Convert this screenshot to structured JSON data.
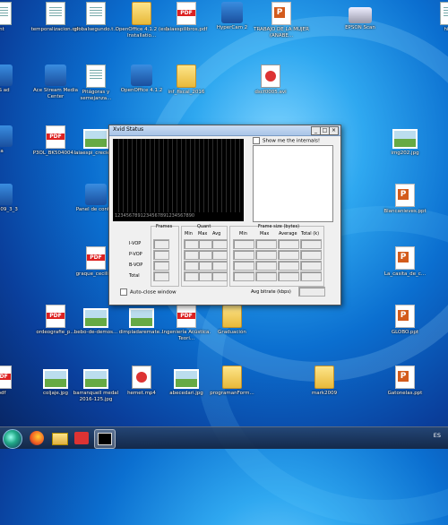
{
  "desktop": {
    "icons": [
      {
        "label": "nt",
        "type": "doc"
      },
      {
        "label": "temporalizacion.odt",
        "type": "doc"
      },
      {
        "label": "globalsegundo.t...",
        "type": "doc"
      },
      {
        "label": "OpenOffice 4.1.2 (es) Installatio...",
        "type": "folder"
      },
      {
        "label": "laiaespilibros.pdf",
        "type": "pdf"
      },
      {
        "label": "HyperCam 2",
        "type": "app"
      },
      {
        "label": "TRABAJO DE LA MUJER (ANABE...",
        "type": "ppt"
      },
      {
        "label": "EPSON Scan",
        "type": "scan"
      },
      {
        "label": "hiwa",
        "type": "doc"
      },
      {
        "label": "ISS ad",
        "type": "app"
      },
      {
        "label": "Ace Stream Media Center",
        "type": "app"
      },
      {
        "label": "Pitágoras y semejanza...",
        "type": "doc"
      },
      {
        "label": "OpenOffice 4.1.2",
        "type": "app"
      },
      {
        "label": "inf_fiscal_2016",
        "type": "folder"
      },
      {
        "label": "dscf0005.avi",
        "type": "vid"
      },
      {
        "label": "a",
        "type": "app"
      },
      {
        "label": "P3OL_BK504004...",
        "type": "pdf"
      },
      {
        "label": "laiaespi_crecien...",
        "type": "img"
      },
      {
        "label": "img202.jpg",
        "type": "img"
      },
      {
        "label": "Blancanieves.ppt",
        "type": "ppt"
      },
      {
        "label": "DJI 2009_3_3",
        "type": "app"
      },
      {
        "label": "Panel de control",
        "type": "app"
      },
      {
        "label": "La_casita_de_c...",
        "type": "ppt"
      },
      {
        "label": "graque_cecilia...",
        "type": "pdf"
      },
      {
        "label": "ordeografie_p...",
        "type": "pdf"
      },
      {
        "label": "bebo-de-demos...",
        "type": "img"
      },
      {
        "label": "dimpladaremate...",
        "type": "img"
      },
      {
        "label": "Ingeniería Acústica. Teori...",
        "type": "pdf"
      },
      {
        "label": "Graduación",
        "type": "folder"
      },
      {
        "label": "GLOBO.ppt",
        "type": "ppt"
      },
      {
        "label": "coljaje.jpg",
        "type": "img"
      },
      {
        "label": "barranquell medal 2016-125.jpg",
        "type": "img"
      },
      {
        "label": "hemet.mp4",
        "type": "vid"
      },
      {
        "label": "abecedari.jpg",
        "type": "img"
      },
      {
        "label": "programanForm...",
        "type": "folder"
      },
      {
        "label": "mark2009",
        "type": "folder"
      },
      {
        "label": "Gatonelas.ppt",
        "type": "ppt"
      },
      {
        "label": "pdf",
        "type": "pdf"
      }
    ]
  },
  "dialog": {
    "title": "Xvid Status",
    "show_internals": "Show me the internals!",
    "ticks": "1234567891234567891234567890",
    "frames_header": "Frames",
    "quant_header": "Quant",
    "quant_cols": [
      "Min",
      "Max",
      "Avg"
    ],
    "rows": [
      "I-VOP",
      "P-VOP",
      "B-VOP",
      "Total"
    ],
    "framesize_header": "Frame size (bytes)",
    "framesize_cols": [
      "Min",
      "Max",
      "Average",
      "Total (k)"
    ],
    "auto_close": "Auto-close window",
    "avg_bitrate": "Avg bitrate (kbps)"
  },
  "taskbar": {
    "lang": "ES"
  }
}
